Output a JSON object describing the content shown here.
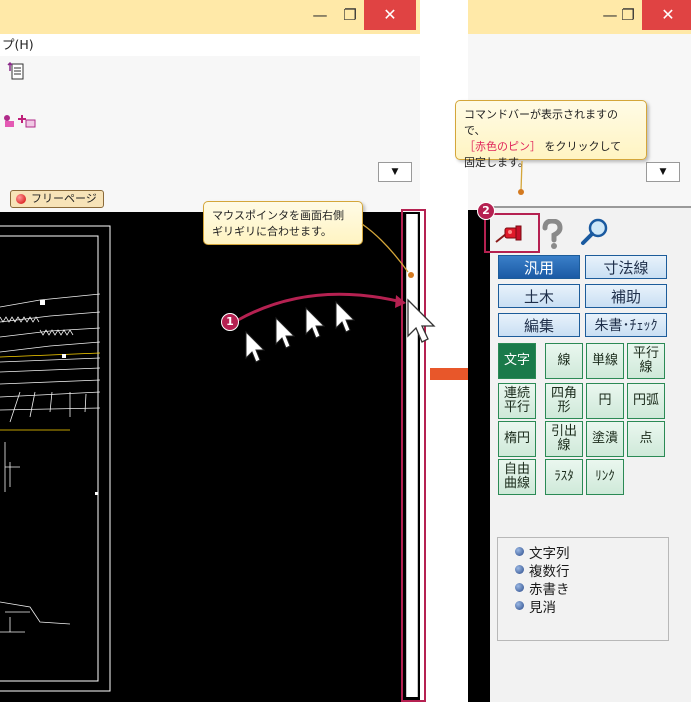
{
  "left_window": {
    "menu_partial": "プ(H)",
    "minimize": "—",
    "maximize": "❐",
    "close": "✕",
    "dropdown_arrow": "▼",
    "page_button_label": "フリーページ"
  },
  "right_window": {
    "minimize": "—",
    "maximize": "❐",
    "close": "✕",
    "dropdown_arrow": "▼",
    "categories": [
      "汎用",
      "寸法線",
      "土木",
      "補助",
      "編集",
      "朱書･ﾁｪｯｸ"
    ],
    "tools": [
      "文字",
      "線",
      "単線",
      "平行\n線",
      "連続\n平行",
      "四角\n形",
      "円",
      "円弧",
      "楕円",
      "引出\n線",
      "塗潰",
      "点",
      "自由\n曲線",
      "ﾗｽﾀ",
      "ﾘﾝｸ"
    ],
    "list_items": [
      "文字列",
      "複数行",
      "赤書き",
      "見消"
    ]
  },
  "callouts": {
    "step1_text": "マウスポインタを画面右側ギリギリに合わせます。",
    "step2_line1": "コマンドバーが表示されますので、",
    "step2_highlight": "［赤色のピン］",
    "step2_line2": "をクリックして",
    "step2_line3": "固定します。"
  },
  "steps": {
    "one": "1",
    "two": "2"
  },
  "colors": {
    "accent_magenta": "#b52151",
    "titlebar": "#ffe9a8",
    "close_red": "#e04343",
    "arrow_orange": "#e8572a",
    "blue_button": "#1c5c9a",
    "green_button": "#2b8a55",
    "callout_highlight": "#e0245a"
  }
}
